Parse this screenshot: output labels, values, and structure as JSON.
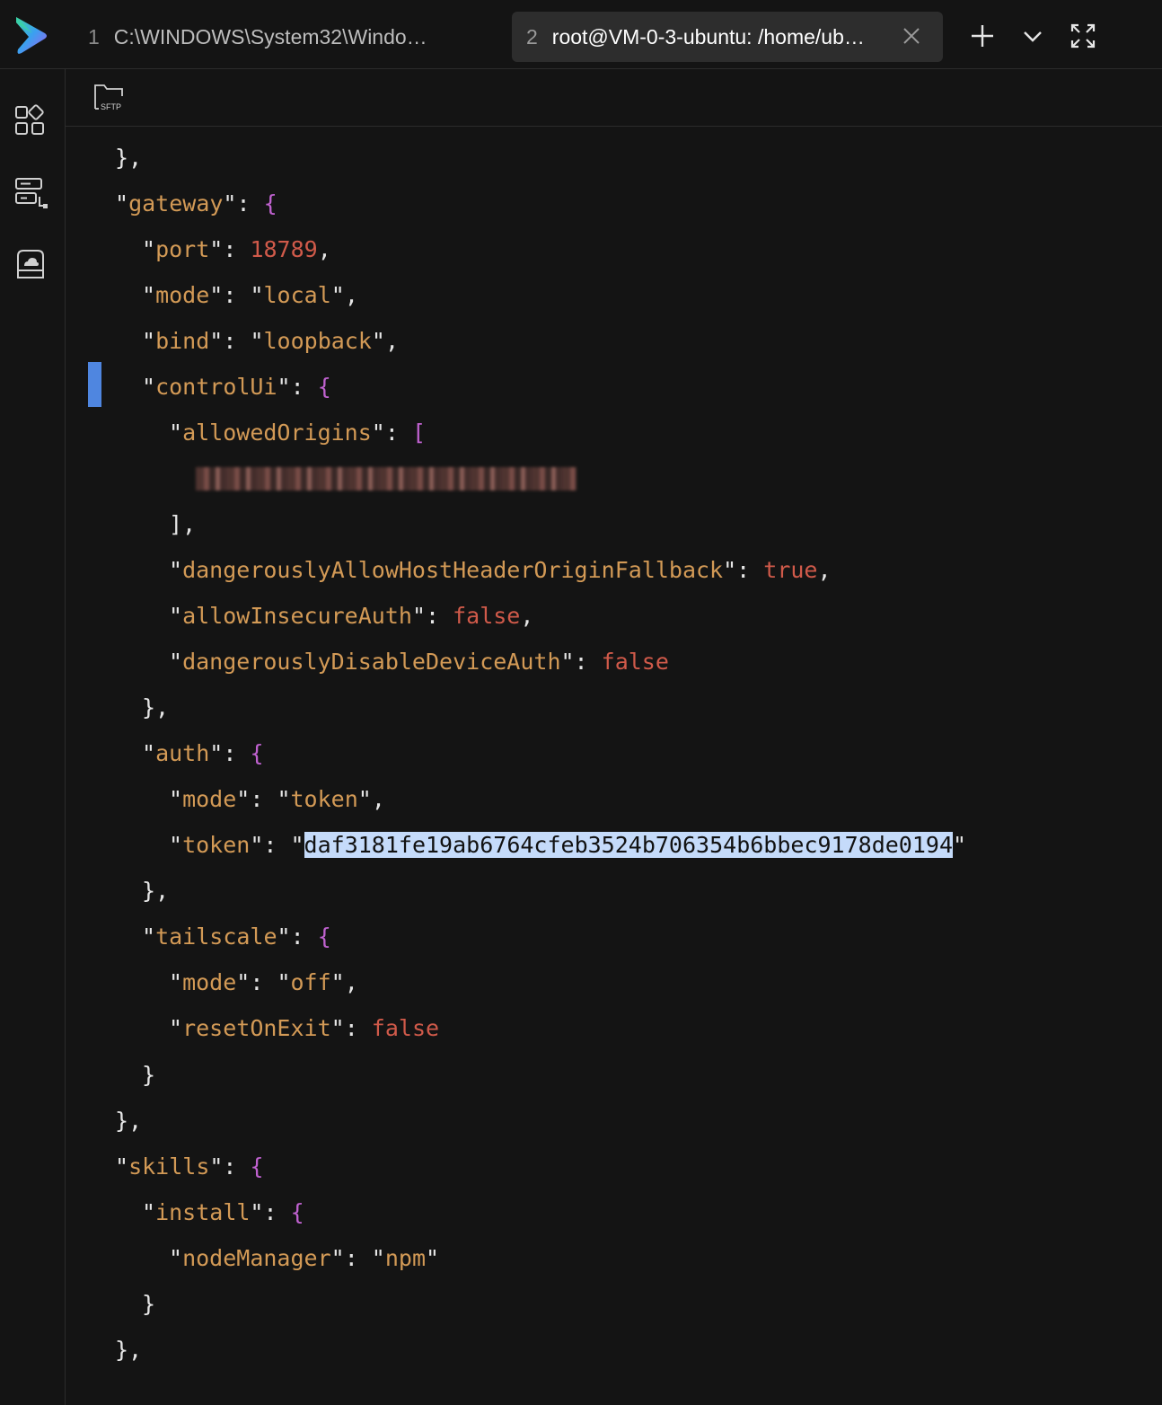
{
  "tabs": [
    {
      "number": "1",
      "title": "C:\\WINDOWS\\System32\\Windo…"
    },
    {
      "number": "2",
      "title": "root@VM-0-3-ubuntu: /home/ub…"
    }
  ],
  "toolbar": {
    "sftp_label": "SFTP"
  },
  "colors": {
    "background": "#141414",
    "json_key": "#d39a56",
    "json_value": "#d05a4a",
    "json_bracket": "#c062d0",
    "selection": "#c5dbfa",
    "gutter_marker": "#4f86e0"
  },
  "terminal": {
    "lines": [
      {
        "p": "},"
      },
      {
        "k": "gateway",
        "open": "{"
      },
      {
        "k": "port",
        "num": "18789",
        "trail": ","
      },
      {
        "k": "mode",
        "str": "local",
        "trail": ","
      },
      {
        "k": "bind",
        "str": "loopback",
        "trail": ","
      },
      {
        "k": "controlUi",
        "open": "{"
      },
      {
        "k": "allowedOrigins",
        "open": "["
      },
      {
        "redacted": true
      },
      {
        "p": "],"
      },
      {
        "k": "dangerouslyAllowHostHeaderOriginFallback",
        "num": "true",
        "trail": ","
      },
      {
        "k": "allowInsecureAuth",
        "num": "false",
        "trail": ","
      },
      {
        "k": "dangerouslyDisableDeviceAuth",
        "num": "false",
        "trail": ""
      },
      {
        "p": "},"
      },
      {
        "k": "auth",
        "open": "{"
      },
      {
        "k": "mode",
        "str": "token",
        "trail": ","
      },
      {
        "k": "token",
        "str": "daf3181fe19ab6764cfeb3524b706354b6bbec9178de0194",
        "selected": true,
        "trail": ""
      },
      {
        "p": "},"
      },
      {
        "k": "tailscale",
        "open": "{"
      },
      {
        "k": "mode",
        "str": "off",
        "trail": ","
      },
      {
        "k": "resetOnExit",
        "num": "false",
        "trail": ""
      },
      {
        "p": "}"
      },
      {
        "p": "},"
      },
      {
        "k": "skills",
        "open": "{"
      },
      {
        "k": "install",
        "open": "{"
      },
      {
        "k": "nodeManager",
        "str": "npm",
        "trail": ""
      },
      {
        "p": "}"
      },
      {
        "p": "},"
      }
    ]
  }
}
